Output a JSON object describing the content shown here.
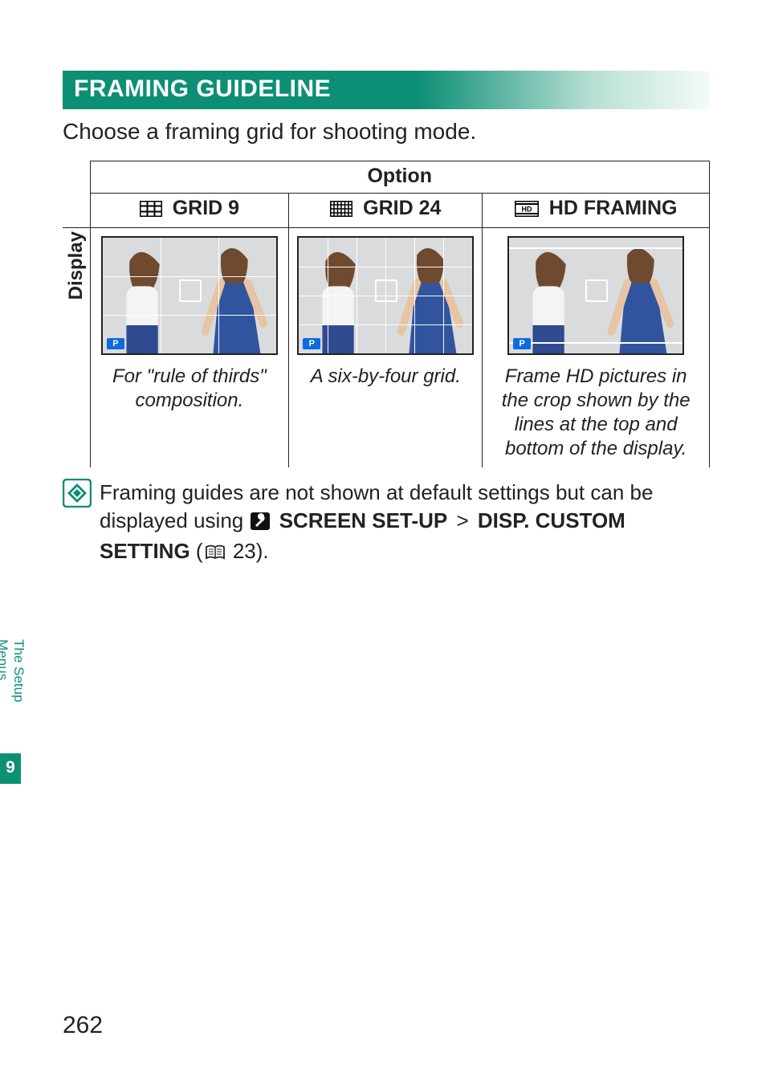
{
  "section": {
    "heading": "FRAMING GUIDELINE",
    "intro": "Choose a framing grid for shooting mode."
  },
  "table": {
    "option_header": "Option",
    "display_label": "Display",
    "columns": [
      {
        "icon": "grid9-icon",
        "label": "GRID 9",
        "caption": "For \"rule of thirds\" composition.",
        "p_badge": "P"
      },
      {
        "icon": "grid24-icon",
        "label": "GRID 24",
        "caption": "A six-by-four grid.",
        "p_badge": "P"
      },
      {
        "icon": "hdframing-icon",
        "label": "HD FRAMING",
        "caption": "Frame HD pictures in the crop shown by the lines at the top and bottom of the display.",
        "p_badge": "P"
      }
    ]
  },
  "note": {
    "prefix": "Framing guides are not shown at default settings but can be displayed using ",
    "menu_path_1": "SCREEN SET-UP",
    "gt": ">",
    "menu_path_2": "DISP. CUSTOM SETTING",
    "page_open": " (",
    "page_ref": "23",
    "page_close": ")."
  },
  "side_tab": {
    "label": "The Setup Menus",
    "chapter": "9"
  },
  "page_number": "262"
}
